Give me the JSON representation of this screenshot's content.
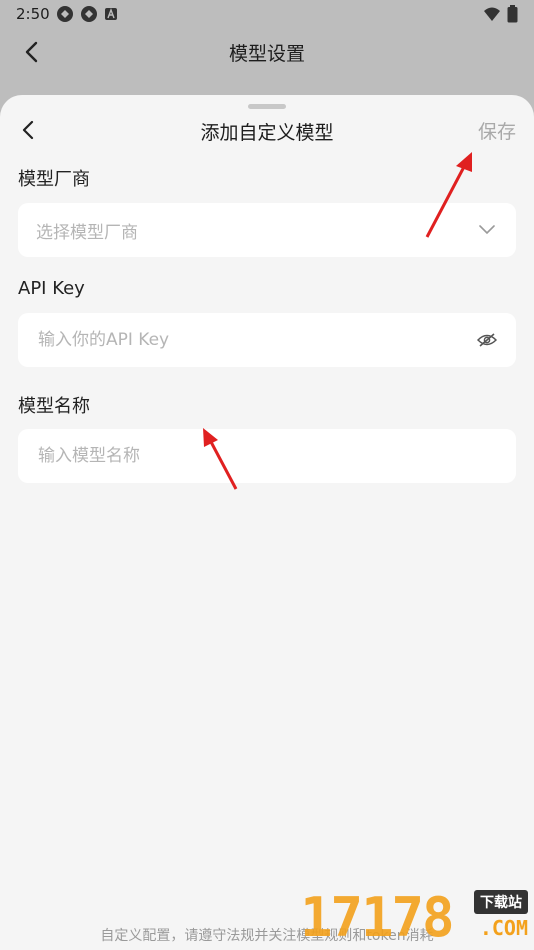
{
  "status_bar": {
    "time": "2:50"
  },
  "app_bar": {
    "title": "模型设置"
  },
  "sheet": {
    "title": "添加自定义模型",
    "save_label": "保存"
  },
  "form": {
    "vendor_label": "模型厂商",
    "vendor_placeholder": "选择模型厂商",
    "api_key_label": "API Key",
    "api_key_placeholder": "输入你的API Key",
    "model_name_label": "模型名称",
    "model_name_placeholder": "输入模型名称"
  },
  "footer": {
    "notice": "自定义配置，请遵守法规并关注模型规则和token消耗"
  },
  "watermark": {
    "number": "17178",
    "tag": "下载站",
    "domain": ".COM"
  },
  "colors": {
    "accent_arrow": "#e02020",
    "sheet_bg": "#f5f5f5",
    "overlay": "#bdbdbd"
  }
}
